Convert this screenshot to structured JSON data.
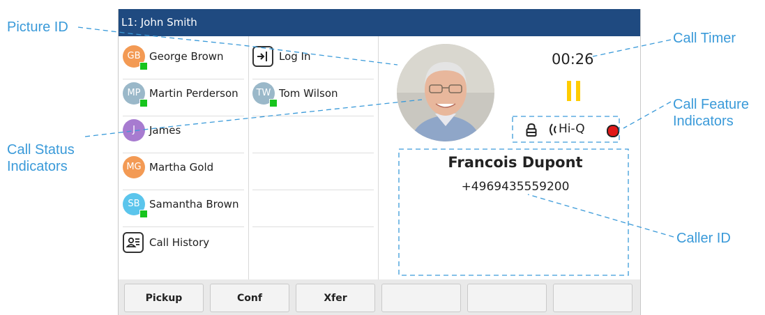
{
  "annotations": {
    "picture_id": "Picture ID",
    "call_status_line1": "Call Status",
    "call_status_line2": "Indicators",
    "call_timer": "Call Timer",
    "call_feature_line1": "Call Feature",
    "call_feature_line2": "Indicators",
    "caller_id": "Caller ID"
  },
  "phone": {
    "title": "L1: John Smith",
    "left_keys": [
      {
        "initials": "GB",
        "label": "George Brown",
        "color": "#f39a54",
        "presence": true
      },
      {
        "initials": "MP",
        "label": "Martin Perderson",
        "color": "#9ab8c9",
        "presence": true
      },
      {
        "initials": "J",
        "label": "James",
        "color": "#a77bd0",
        "presence": false
      },
      {
        "initials": "MG",
        "label": "Martha Gold",
        "color": "#f39a54",
        "presence": false
      },
      {
        "initials": "SB",
        "label": "Samantha Brown",
        "color": "#5bc5ec",
        "presence": true
      },
      {
        "icon": "call-history-icon",
        "label": "Call History"
      }
    ],
    "middle_keys": [
      {
        "icon": "log-in-icon",
        "label": "Log In"
      },
      {
        "initials": "TW",
        "label": "Tom Wilson",
        "color": "#9ab8c9",
        "presence": true
      }
    ],
    "call": {
      "timer": "00:26",
      "status": "paused",
      "status_color": "#ffcc00",
      "features": {
        "lock": "lock-icon",
        "hd_label": "Hi-Q",
        "record": "record-icon",
        "record_color": "#e01818"
      },
      "caller_name": "Francois Dupont",
      "caller_number": "+4969435559200"
    },
    "softkeys": [
      "Pickup",
      "Conf",
      "Xfer",
      "",
      "",
      ""
    ]
  }
}
